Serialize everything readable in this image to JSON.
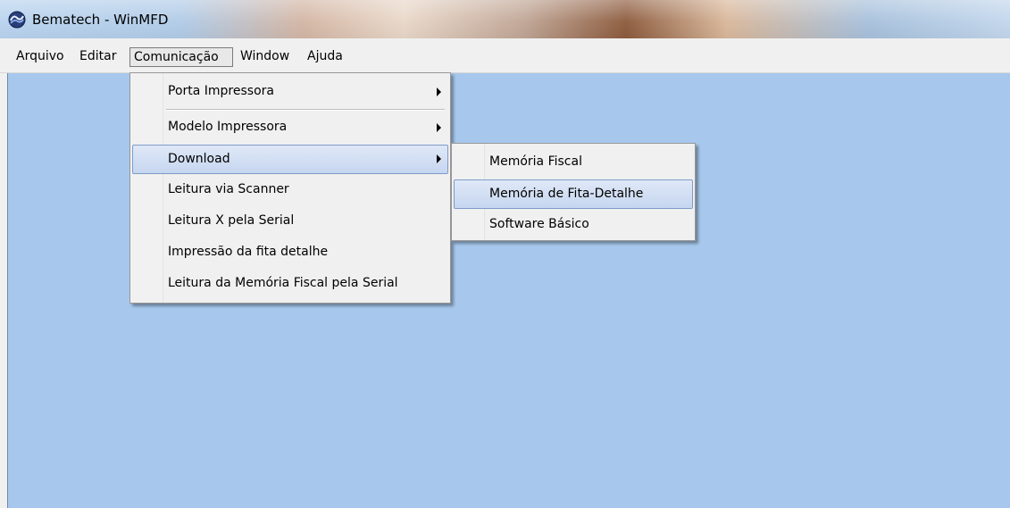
{
  "window": {
    "title": "Bematech - WinMFD",
    "icon": "bematech-app-icon"
  },
  "menubar": {
    "items": [
      {
        "label": "Arquivo"
      },
      {
        "label": "Editar"
      },
      {
        "label": "Comunicação"
      },
      {
        "label": "Window"
      },
      {
        "label": "Ajuda"
      }
    ]
  },
  "comunicacao_menu": {
    "items": [
      {
        "label": "Porta Impressora",
        "submenu": true
      },
      {
        "label": "Modelo Impressora",
        "submenu": true
      },
      {
        "label": "Download",
        "submenu": true,
        "highlighted": true
      },
      {
        "label": "Leitura via Scanner"
      },
      {
        "label": "Leitura X pela Serial"
      },
      {
        "label": "Impressão da fita detalhe"
      },
      {
        "label": "Leitura da Memória Fiscal pela Serial"
      }
    ]
  },
  "download_submenu": {
    "items": [
      {
        "label": "Memória Fiscal"
      },
      {
        "label": "Memória de Fita-Detalhe",
        "highlighted": true
      },
      {
        "label": "Software Básico"
      }
    ]
  },
  "colors": {
    "client_background": "#a7c8ec",
    "menu_background": "#f0f0f0",
    "highlight": "#c6d6f0",
    "highlight_border": "#7f9bc9"
  }
}
